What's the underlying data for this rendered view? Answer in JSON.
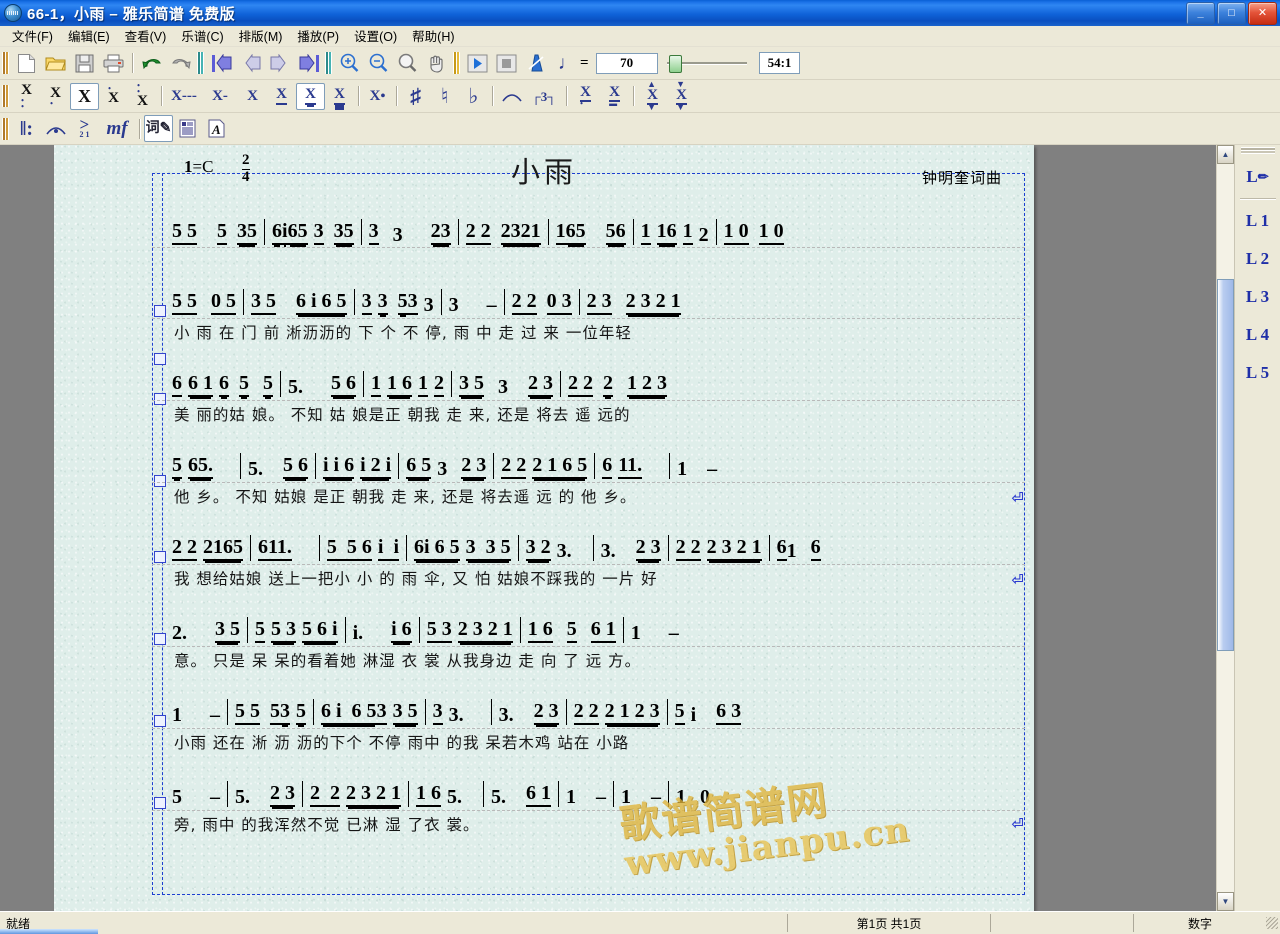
{
  "window": {
    "title": "66-1，小雨 – 雅乐简谱 免费版",
    "app_icon": "globe-icon",
    "buttons": {
      "minimize": "_",
      "maximize": "□",
      "close": "✕"
    }
  },
  "menu": [
    {
      "label": "文件(F)",
      "name": "menu-file"
    },
    {
      "label": "编辑(E)",
      "name": "menu-edit"
    },
    {
      "label": "查看(V)",
      "name": "menu-view"
    },
    {
      "label": "乐谱(C)",
      "name": "menu-score"
    },
    {
      "label": "排版(M)",
      "name": "menu-layout"
    },
    {
      "label": "播放(P)",
      "name": "menu-play"
    },
    {
      "label": "设置(O)",
      "name": "menu-settings"
    },
    {
      "label": "帮助(H)",
      "name": "menu-help"
    }
  ],
  "toolbar_main": {
    "buttons": [
      {
        "name": "new-file-icon",
        "glyph": "📄"
      },
      {
        "name": "open-folder-icon",
        "glyph": "📂"
      },
      {
        "name": "save-icon",
        "glyph": "💾"
      },
      {
        "name": "print-icon",
        "glyph": "🖨"
      },
      {
        "name": "undo-icon",
        "glyph": "↶"
      },
      {
        "name": "redo-icon",
        "glyph": "↷"
      },
      {
        "name": "first-page-icon",
        "glyph": "|⇦"
      },
      {
        "name": "previous-page-icon",
        "glyph": "⇦"
      },
      {
        "name": "next-page-icon",
        "glyph": "⇨"
      },
      {
        "name": "last-page-icon",
        "glyph": "⇨|"
      },
      {
        "name": "zoom-in-icon",
        "glyph": "🔍+"
      },
      {
        "name": "zoom-out-icon",
        "glyph": "🔍-"
      },
      {
        "name": "zoom-fit-icon",
        "glyph": "🔍"
      },
      {
        "name": "pan-hand-icon",
        "glyph": "✋"
      },
      {
        "name": "play-icon",
        "glyph": "▶"
      },
      {
        "name": "stop-icon",
        "glyph": "■"
      },
      {
        "name": "metronome-icon",
        "glyph": "◣"
      }
    ],
    "tempo_note_glyph": "♩",
    "tempo_equals": "=",
    "tempo_value": "70",
    "time_display": "54:1"
  },
  "toolbar_notes": {
    "buttons": [
      {
        "name": "note-low-octave-double-icon",
        "glyph": "X"
      },
      {
        "name": "note-low-octave-icon",
        "glyph": "X"
      },
      {
        "name": "note-natural-octave-icon",
        "glyph": "X",
        "selected": true
      },
      {
        "name": "note-high-octave-icon",
        "glyph": "X"
      },
      {
        "name": "note-high-octave-double-icon",
        "glyph": "X"
      },
      {
        "name": "note-dash-triple-icon",
        "glyph": "X---"
      },
      {
        "name": "note-dash-single-icon",
        "glyph": "X-"
      },
      {
        "name": "note-quarter-icon",
        "glyph": "X"
      },
      {
        "name": "note-eighth-icon",
        "glyph": "X"
      },
      {
        "name": "note-sixteenth-icon",
        "glyph": "X",
        "selected": true
      },
      {
        "name": "note-thirtysecond-icon",
        "glyph": "X"
      },
      {
        "name": "note-dotted-icon",
        "glyph": "X."
      },
      {
        "name": "sharp-icon",
        "glyph": "♯"
      },
      {
        "name": "natural-icon",
        "glyph": "♮"
      },
      {
        "name": "flat-icon",
        "glyph": "♭"
      },
      {
        "name": "slur-icon",
        "glyph": "⌒"
      },
      {
        "name": "triplet-icon",
        "glyph": "3"
      },
      {
        "name": "note-underline-dot-icon",
        "glyph": "X"
      },
      {
        "name": "note-underline-dot2-icon",
        "glyph": "X"
      },
      {
        "name": "note-grace-upper-icon",
        "glyph": "X"
      },
      {
        "name": "note-grace-lower-icon",
        "glyph": "X"
      }
    ]
  },
  "toolbar_marks": {
    "buttons": [
      {
        "name": "repeat-barline-icon",
        "glyph": "‖:"
      },
      {
        "name": "fermata-icon",
        "glyph": "⌒"
      },
      {
        "name": "accent-icon",
        "glyph": ">"
      },
      {
        "name": "dynamics-mf-icon",
        "glyph": "mf"
      },
      {
        "name": "lyrics-edit-icon",
        "glyph": "词",
        "selected": true
      },
      {
        "name": "text-block-icon",
        "glyph": "▤"
      },
      {
        "name": "text-format-icon",
        "glyph": "A"
      }
    ]
  },
  "score": {
    "key_signature_label": "1",
    "key_signature_equals": "=",
    "key_signature_value": "C",
    "meter_numerator": "2",
    "meter_denominator": "4",
    "title": "小雨",
    "composer": "钟明奎词曲",
    "systems": [
      {
        "index": 1,
        "notes": "5 5  5 35 | 6i65 3 35 | 3 3   23 | 2 2  2321 | 165    56 | 1 16 1 2 | 1 0  1 0",
        "lyrics": ""
      },
      {
        "index": 2,
        "notes": "5 5 0 5 | 3 5  6 i 6 5 | 3 3 5 3 3 | 3  –  | 2 2 0 3 | 2 3  2 3 2 1",
        "lyrics": "小 雨    在   门 前 淅沥沥的   下 个    不 停,        雨 中    走   过 来 一位年轻"
      },
      {
        "index": 3,
        "notes": "6 6 1 6  5   5 | 5.    5 6 | 1 1 6 1 1 2 | 3 5  3    2 3 | 2 2  2   1 2 3",
        "lyrics": "美 丽的姑      娘。      不知  姑 娘是正 朝我  走    来,   还是  将去  遥    远的"
      },
      {
        "index": 4,
        "notes": "5 65.    5.    5 6 | i i 6 i 2 i | 6 5 3   2 3 | 2 2 2 1 6 5 | 6 11.     1  –",
        "lyrics": "他   乡。       不知  姑娘 是正 朝我 走   来, 还是  将去遥   远 的 他  乡。"
      },
      {
        "index": 5,
        "notes": "2 2 2165 | 611.    5 5 6 i i | 6i 6 5 3 3 5 | 3 2 3.    3.    2 3 | 2 2 2 3 2 1 | 6 1   6",
        "lyrics": "我 想给姑娘  送上一把小 小 的  雨   伞,      又 怕 姑娘不踩我的 一片  好"
      },
      {
        "index": 6,
        "notes": "2.    3 5 | 5 5 3 5 6 i | i.     i 6 | 5 3  2 3 2 1 | 1 6  5    6 1 | 1    –",
        "lyrics": "意。    只是  呆 呆的看着她       淋湿  衣 裳 从我身边  走    向   了 远  方。"
      },
      {
        "index": 7,
        "notes": "1   –  | 5 5 5 3 5 | 6 i 6 5 3 3 5 | 3 3.     3.    2 3 | 2 2 2 1 2 3 | 5 i    6 3",
        "lyrics": "小雨 还在   淅 沥 沥的下个    不停       雨中  的我 呆若木鸡  站在   小路"
      },
      {
        "index": 8,
        "notes": "5    –   | 5.    2 3 | 2 2 2 3 2 1 | 1 6 5.     5.    6 1 | 1   –  | 1   –  | 1  0",
        "lyrics": "旁,        雨中  的我浑然不觉   已淋 湿       了衣  裳。"
      }
    ]
  },
  "right_dock": {
    "top_item": {
      "label": "L",
      "icon": "pencil-icon"
    },
    "items": [
      {
        "label": "L 1",
        "name": "layer-1"
      },
      {
        "label": "L 2",
        "name": "layer-2"
      },
      {
        "label": "L 3",
        "name": "layer-3"
      },
      {
        "label": "L 4",
        "name": "layer-4"
      },
      {
        "label": "L 5",
        "name": "layer-5"
      }
    ]
  },
  "scrollbar": {
    "up_glyph": "▲",
    "down_glyph": "▼"
  },
  "statusbar": {
    "ready": "就绪",
    "page_info": "第1页 共1页",
    "blank": "",
    "num_mode": "数字"
  },
  "watermark": {
    "line1": "歌谱简谱网",
    "line2": "www.jianpu.cn"
  },
  "colors": {
    "title_bar_blue": "#0f62d8",
    "toolbar_bg": "#ece9d8",
    "paper": "#dfeeea",
    "selection_blue": "#1d3fd0",
    "dock_text": "#1f2fa8",
    "watermark_gold": "#e0b43a"
  }
}
